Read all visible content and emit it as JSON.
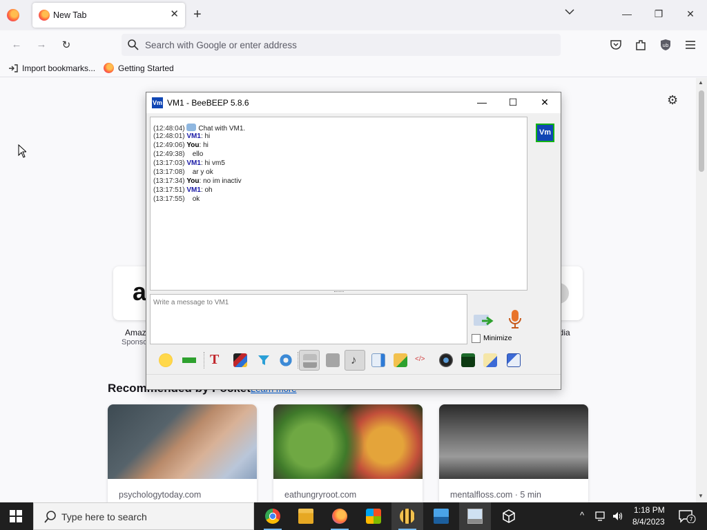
{
  "browser": {
    "tab_title": "New Tab",
    "tab_close": "✕",
    "new_tab": "+",
    "tab_list": "⌄",
    "window_controls": {
      "minimize": "—",
      "maximize": "❐",
      "close": "✕"
    },
    "nav": {
      "back": "←",
      "forward": "→",
      "reload": "↻"
    },
    "url_placeholder": "Search with Google or enter address",
    "bookmarks": [
      {
        "label": "Import bookmarks...",
        "icon": "import-icon"
      },
      {
        "label": "Getting Started",
        "icon": "firefox-icon"
      }
    ]
  },
  "newtab": {
    "tiles": [
      {
        "label": "Amaz",
        "sub": "Sponso",
        "icon": "amazon-icon"
      },
      {
        "label": "edia",
        "sub": "",
        "icon": "wikipedia-icon"
      }
    ],
    "pocket_title": "Recommended by Pocket",
    "pocket_link": "Learn more",
    "cards": [
      {
        "source": "psychologytoday.com"
      },
      {
        "source": "eathungryroot.com"
      },
      {
        "source": "mentalfloss.com · 5 min"
      }
    ]
  },
  "beebeep": {
    "title": "VM1 - BeeBEEP 5.8.6",
    "app_badge": "Vm",
    "chat": [
      {
        "time": "(12:48:04)",
        "who": "",
        "text": "Chat with VM1.",
        "system": true
      },
      {
        "time": "(12:48:01)",
        "who": "VM1",
        "text": ": hi"
      },
      {
        "time": "(12:49:06)",
        "who": "You",
        "text": ": hi"
      },
      {
        "time": "(12:49:38)",
        "who": "",
        "text": "ello"
      },
      {
        "time": "(13:17:03)",
        "who": "VM1",
        "text": ": hi vm5"
      },
      {
        "time": "(13:17:08)",
        "who": "",
        "text": "ar y ok"
      },
      {
        "time": "(13:17:34)",
        "who": "You",
        "text": ": no im inactiv"
      },
      {
        "time": "(13:17:51)",
        "who": "VM1",
        "text": ": oh"
      },
      {
        "time": "(13:17:55)",
        "who": "",
        "text": "ok"
      }
    ],
    "input_placeholder": "Write a message to VM1",
    "minimize_label": "Minimize",
    "user_badge": "Vm"
  },
  "taskbar": {
    "search_placeholder": "Type here to search",
    "time": "1:18 PM",
    "date": "8/4/2023",
    "notification_count": "7"
  }
}
